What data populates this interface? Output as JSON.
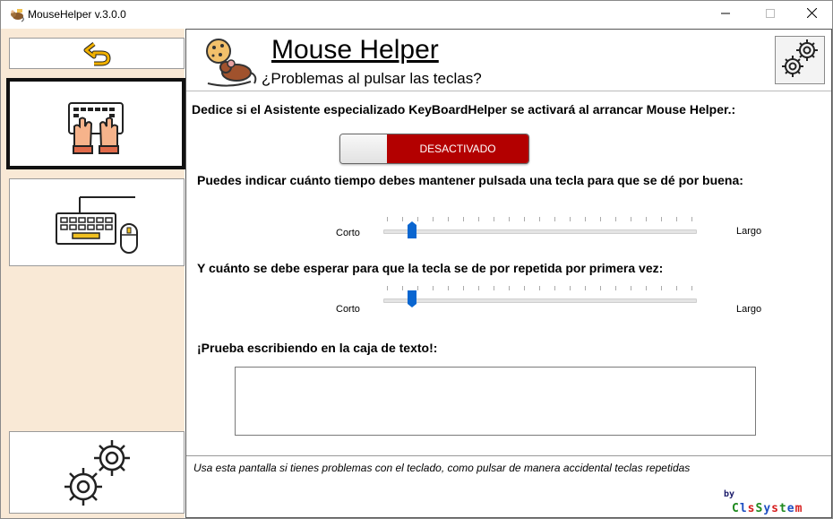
{
  "window": {
    "title": "MouseHelper v.3.0.0",
    "controls": {
      "minimize_icon": "minimize-icon",
      "maximize_icon": "maximize-icon",
      "close_icon": "close-icon"
    }
  },
  "sidebar": {
    "items": [
      {
        "icon": "back-arrow-icon",
        "color": "#f0b000"
      },
      {
        "icon": "keyboard-hands-icon",
        "selected": true
      },
      {
        "icon": "keyboard-mouse-icon"
      },
      {
        "icon": "gears-icon"
      }
    ],
    "background": "#f9e9d6"
  },
  "header": {
    "title": "Mouse Helper",
    "subtitle": "¿Problemas al pulsar las teclas?",
    "logo_icon": "mouse-logo-icon",
    "settings_icon": "gears-icon"
  },
  "content": {
    "assistant_label": "Dedice si el Asistente especializado KeyBoardHelper se activará al arrancar Mouse Helper.:",
    "toggle": {
      "state_label": "DESACTIVADO",
      "on": false,
      "color": "#b30000"
    },
    "hold_label": "Puedes indicar cuánto tiempo debes mantener pulsada una tecla para que se dé por buena:",
    "hold_slider": {
      "min_label": "Corto",
      "max_label": "Largo",
      "value": 0.08
    },
    "repeat_label": "Y cuánto se debe esperar para que la tecla se de por repetida por primera vez:",
    "repeat_slider": {
      "min_label": "Corto",
      "max_label": "Largo",
      "value": 0.08
    },
    "test_label": "¡Prueba escribiendo en la caja de texto!:",
    "test_input": {
      "value": "",
      "placeholder": ""
    }
  },
  "footer": {
    "description": "Usa esta pantalla si tienes problemas con el teclado, como pulsar de manera accidental teclas repetidas",
    "by": "by",
    "brand": "ClsSystem",
    "brand_colors": [
      "#1e8a1e",
      "#1e4fc2",
      "#d61e1e"
    ]
  }
}
